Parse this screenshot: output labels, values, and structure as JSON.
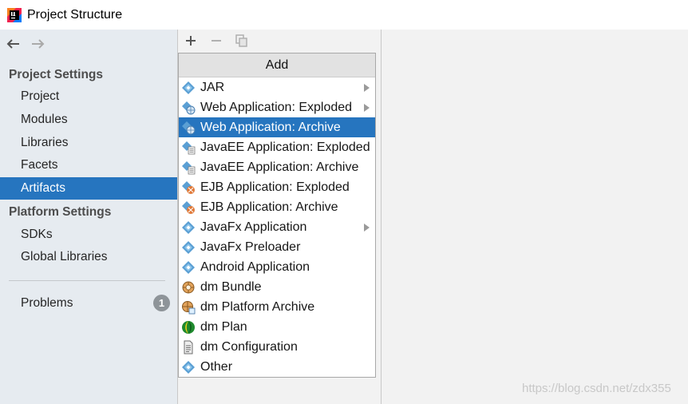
{
  "window": {
    "title": "Project Structure"
  },
  "sidebar": {
    "project_settings_header": "Project Settings",
    "project_items": [
      {
        "label": "Project",
        "selected": false
      },
      {
        "label": "Modules",
        "selected": false
      },
      {
        "label": "Libraries",
        "selected": false
      },
      {
        "label": "Facets",
        "selected": false
      },
      {
        "label": "Artifacts",
        "selected": true
      }
    ],
    "platform_settings_header": "Platform Settings",
    "platform_items": [
      {
        "label": "SDKs"
      },
      {
        "label": "Global Libraries"
      }
    ],
    "problems": {
      "label": "Problems",
      "count": "1"
    }
  },
  "toolbar": {
    "add_icon": "plus-icon",
    "remove_icon": "minus-icon",
    "copy_icon": "copy-icon"
  },
  "add_menu": {
    "header": "Add",
    "items": [
      {
        "label": "JAR",
        "icon": "artifact-diamond-icon",
        "submenu": true,
        "selected": false
      },
      {
        "label": "Web Application: Exploded",
        "icon": "web-artifact-icon",
        "submenu": true,
        "selected": false
      },
      {
        "label": "Web Application: Archive",
        "icon": "web-artifact-icon",
        "submenu": false,
        "selected": true
      },
      {
        "label": "JavaEE Application: Exploded",
        "icon": "javaee-artifact-icon",
        "submenu": false,
        "selected": false
      },
      {
        "label": "JavaEE Application: Archive",
        "icon": "javaee-artifact-icon",
        "submenu": false,
        "selected": false
      },
      {
        "label": "EJB Application: Exploded",
        "icon": "ejb-artifact-icon",
        "submenu": false,
        "selected": false
      },
      {
        "label": "EJB Application: Archive",
        "icon": "ejb-artifact-icon",
        "submenu": false,
        "selected": false
      },
      {
        "label": "JavaFx Application",
        "icon": "artifact-diamond-icon",
        "submenu": true,
        "selected": false
      },
      {
        "label": "JavaFx Preloader",
        "icon": "artifact-diamond-icon",
        "submenu": false,
        "selected": false
      },
      {
        "label": "Android Application",
        "icon": "artifact-diamond-icon",
        "submenu": false,
        "selected": false
      },
      {
        "label": "dm Bundle",
        "icon": "dm-bundle-icon",
        "submenu": false,
        "selected": false
      },
      {
        "label": "dm Platform Archive",
        "icon": "dm-platform-icon",
        "submenu": false,
        "selected": false
      },
      {
        "label": "dm Plan",
        "icon": "dm-plan-icon",
        "submenu": false,
        "selected": false
      },
      {
        "label": "dm Configuration",
        "icon": "dm-config-icon",
        "submenu": false,
        "selected": false
      },
      {
        "label": "Other",
        "icon": "artifact-diamond-icon",
        "submenu": false,
        "selected": false
      }
    ]
  },
  "watermark": "https://blog.csdn.net/zdx355",
  "colors": {
    "selection": "#2675bf",
    "sidebar_bg": "#e6ebf0",
    "popup_header_bg": "#e2e2e2",
    "artifact_icon": "#4f95c9"
  }
}
